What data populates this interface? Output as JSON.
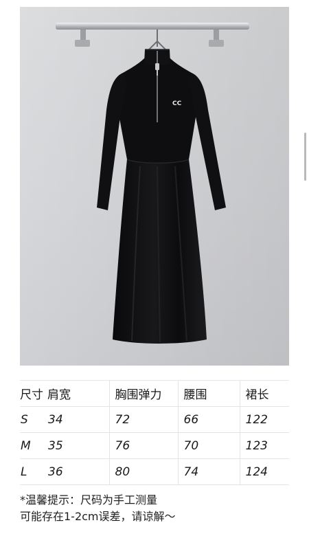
{
  "colors": {
    "background": "#ffffff",
    "photo_wall": "#d8d9dc",
    "dress": "#0e0e10",
    "text": "#1a1a1a"
  },
  "photo": {
    "icon": "dress-on-hanger-photo",
    "logo_text": "CC"
  },
  "size_table": {
    "headers": [
      "尺寸",
      "肩宽",
      "胸围弹力",
      "腰围",
      "裙长"
    ],
    "rows": [
      {
        "size": "S",
        "shoulder": "34",
        "chest": "72",
        "waist": "66",
        "length": "122"
      },
      {
        "size": "M",
        "shoulder": "35",
        "chest": "76",
        "waist": "70",
        "length": "123"
      },
      {
        "size": "L",
        "shoulder": "36",
        "chest": "80",
        "waist": "74",
        "length": "124"
      }
    ]
  },
  "note": {
    "line1": "*温馨提示：尺码为手工测量",
    "line2": "可能存在1-2cm误差，请谅解～"
  }
}
